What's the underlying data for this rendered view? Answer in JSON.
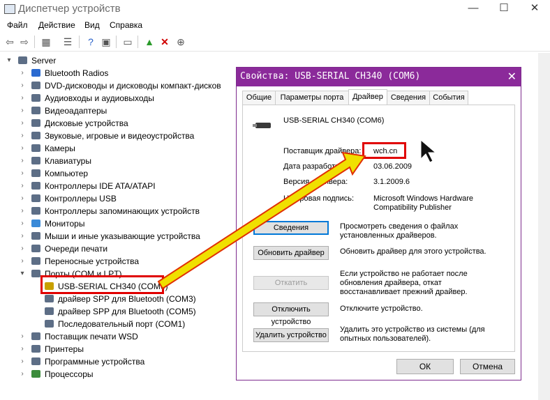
{
  "window": {
    "title": "Диспетчер устройств",
    "minimize": "—",
    "maximize": "☐",
    "close": "✕"
  },
  "menu": [
    "Файл",
    "Действие",
    "Вид",
    "Справка"
  ],
  "tree": {
    "root": "Server",
    "items": [
      {
        "label": "Bluetooth Radios"
      },
      {
        "label": "DVD-дисководы и дисководы компакт-дисков"
      },
      {
        "label": "Аудиовходы и аудиовыходы"
      },
      {
        "label": "Видеоадаптеры"
      },
      {
        "label": "Дисковые устройства"
      },
      {
        "label": "Звуковые, игровые и видеоустройства"
      },
      {
        "label": "Камеры"
      },
      {
        "label": "Клавиатуры"
      },
      {
        "label": "Компьютер"
      },
      {
        "label": "Контроллеры IDE ATA/ATAPI"
      },
      {
        "label": "Контроллеры USB"
      },
      {
        "label": "Контроллеры запоминающих устройств"
      },
      {
        "label": "Мониторы"
      },
      {
        "label": "Мыши и иные указывающие устройства"
      },
      {
        "label": "Очереди печати"
      },
      {
        "label": "Переносные устройства"
      },
      {
        "label": "Порты (COM и LPT)"
      }
    ],
    "ports_children": [
      {
        "label": "USB-SERIAL CH340 (COM6)"
      },
      {
        "label": "драйвер SPP для Bluetooth (COM3)"
      },
      {
        "label": "драйвер SPP для Bluetooth (COM5)"
      },
      {
        "label": "Последовательный порт (COM1)"
      }
    ],
    "items_after": [
      {
        "label": "Поставщик печати WSD"
      },
      {
        "label": "Принтеры"
      },
      {
        "label": "Программные устройства"
      },
      {
        "label": "Процессоры"
      }
    ]
  },
  "dialog": {
    "title": "Свойства: USB-SERIAL CH340 (COM6)",
    "close": "✕",
    "tabs": [
      "Общие",
      "Параметры порта",
      "Драйвер",
      "Сведения",
      "События"
    ],
    "active_tab": "Драйвер",
    "device_name": "USB-SERIAL CH340 (COM6)",
    "fields": [
      {
        "label": "Поставщик драйвера:",
        "value": "wch.cn"
      },
      {
        "label": "Дата разработки:",
        "value": "03.06.2009"
      },
      {
        "label": "Версия драйвера:",
        "value": "3.1.2009.6"
      },
      {
        "label": "Цифровая подпись:",
        "value": "Microsoft Windows Hardware",
        "value2": "Compatibility Publisher"
      }
    ],
    "buttons": [
      {
        "label": "Сведения",
        "desc": "Просмотреть сведения о файлах",
        "desc2": "установленных драйверов."
      },
      {
        "label": "Обновить драйвер",
        "desc": "Обновить драйвер для этого устройства.",
        "desc2": ""
      },
      {
        "label": "Откатить",
        "desc": "Если устройство не работает после",
        "desc2": "обновления драйвера, откат",
        "desc3": "восстанавливает прежний драйвер."
      },
      {
        "label": "Отключить устройство",
        "desc": "Отключите устройство.",
        "desc2": ""
      },
      {
        "label": "Удалить устройство",
        "desc": "Удалить это устройство из системы (для",
        "desc2": "опытных пользователей)."
      }
    ],
    "ok": "ОК",
    "cancel": "Отмена"
  },
  "colors": {
    "dialog_title": "#8b2a9a",
    "highlight_box": "#e00000",
    "arrow": "#f0e000"
  }
}
